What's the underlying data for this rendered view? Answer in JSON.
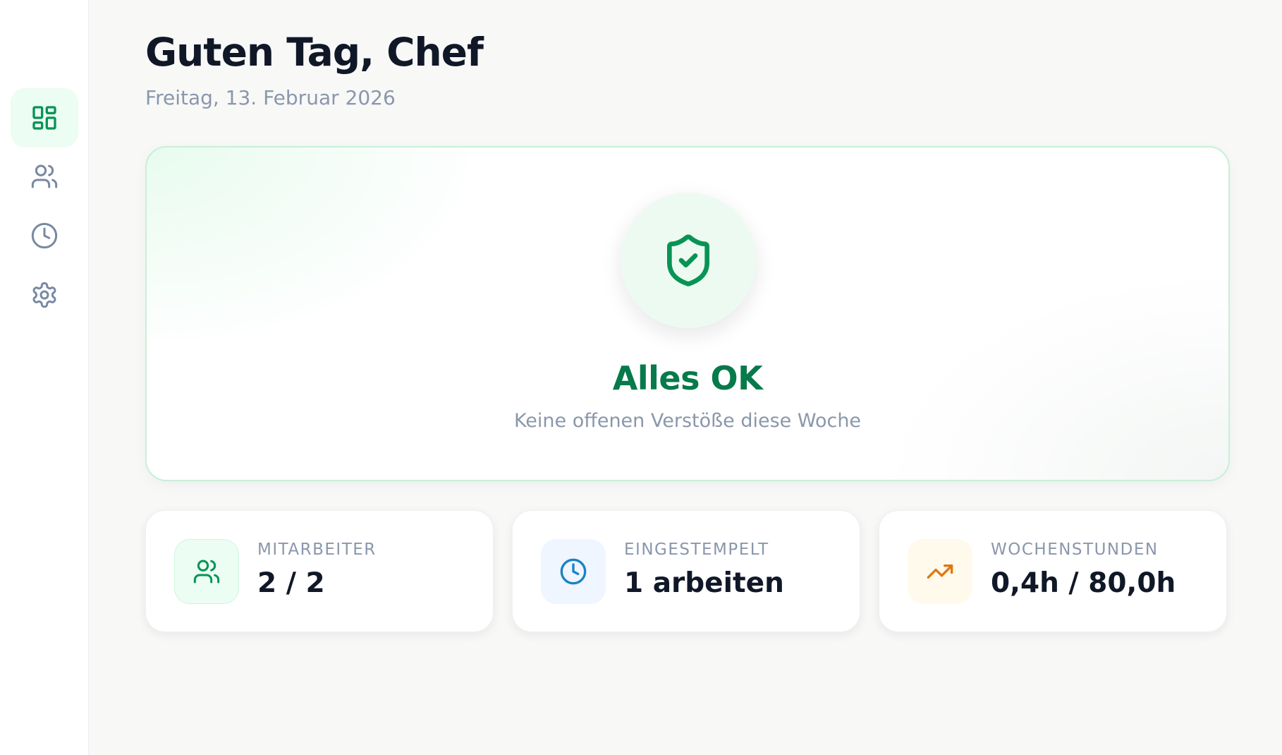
{
  "sidebar": {
    "items": [
      {
        "icon": "dashboard-icon",
        "active": true
      },
      {
        "icon": "users-icon",
        "active": false
      },
      {
        "icon": "clock-icon",
        "active": false
      },
      {
        "icon": "gear-icon",
        "active": false
      }
    ]
  },
  "header": {
    "greeting": "Guten Tag, Chef",
    "date": "Freitag, 13. Februar 2026"
  },
  "status": {
    "icon": "shield-check-icon",
    "title": "Alles OK",
    "subtitle": "Keine offenen Verstöße diese Woche"
  },
  "stats": [
    {
      "icon": "users-icon",
      "label": "MITARBEITER",
      "value": "2 / 2",
      "color": "#079455",
      "bg": "#ecfdf3"
    },
    {
      "icon": "clock-icon",
      "label": "EINGESTEMPELT",
      "value": "1 arbeiten",
      "color": "#1a82c4",
      "bg": "#eff6ff"
    },
    {
      "icon": "trending-up-icon",
      "label": "WOCHENSTUNDEN",
      "value": "0,4h / 80,0h",
      "color": "#e07712",
      "bg": "#fffaeb"
    }
  ],
  "colors": {
    "accent": "#079455",
    "status_text": "#067a4a",
    "muted": "#8a97ab",
    "nav_icon": "#7889a1"
  }
}
